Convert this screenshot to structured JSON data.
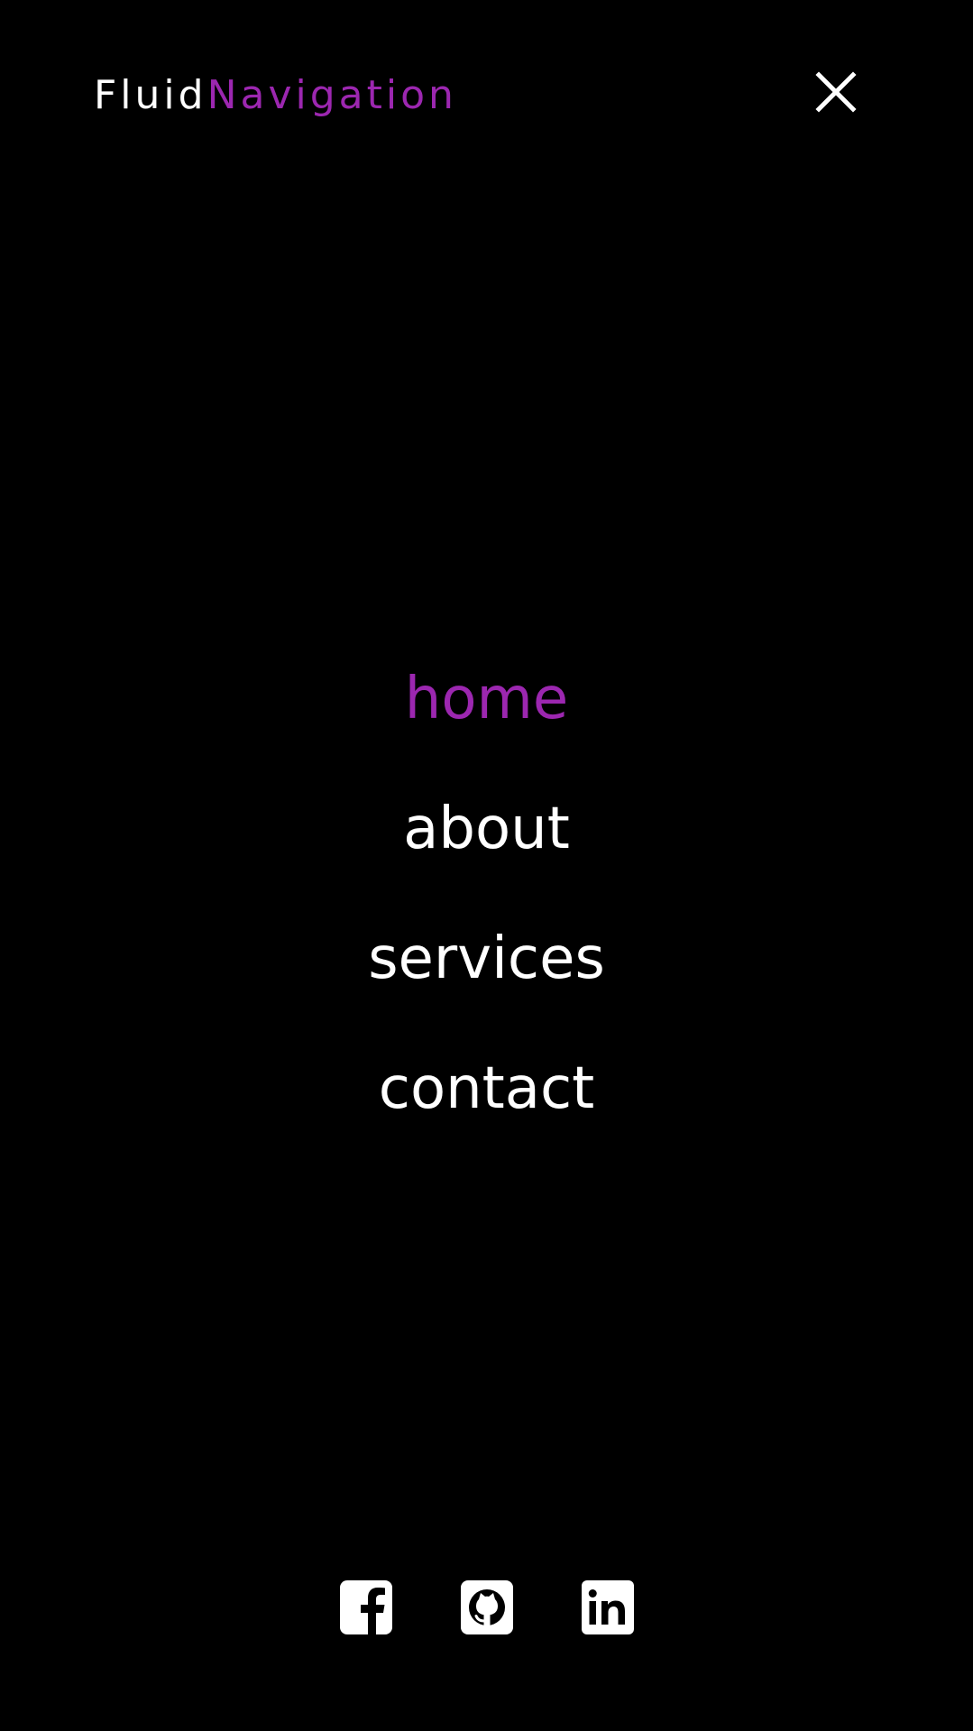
{
  "brand": {
    "part1": "Fluid",
    "part2": "Navigation",
    "accent_color": "#9c27b0"
  },
  "close_button": {
    "icon": "close-icon"
  },
  "menu": {
    "items": [
      {
        "label": "home",
        "active": true
      },
      {
        "label": "about",
        "active": false
      },
      {
        "label": "services",
        "active": false
      },
      {
        "label": "contact",
        "active": false
      }
    ]
  },
  "socials": [
    {
      "name": "facebook",
      "icon": "facebook-icon"
    },
    {
      "name": "github",
      "icon": "github-icon"
    },
    {
      "name": "linkedin",
      "icon": "linkedin-icon"
    }
  ],
  "colors": {
    "background": "#000000",
    "text": "#ffffff",
    "accent": "#9c27b0"
  }
}
